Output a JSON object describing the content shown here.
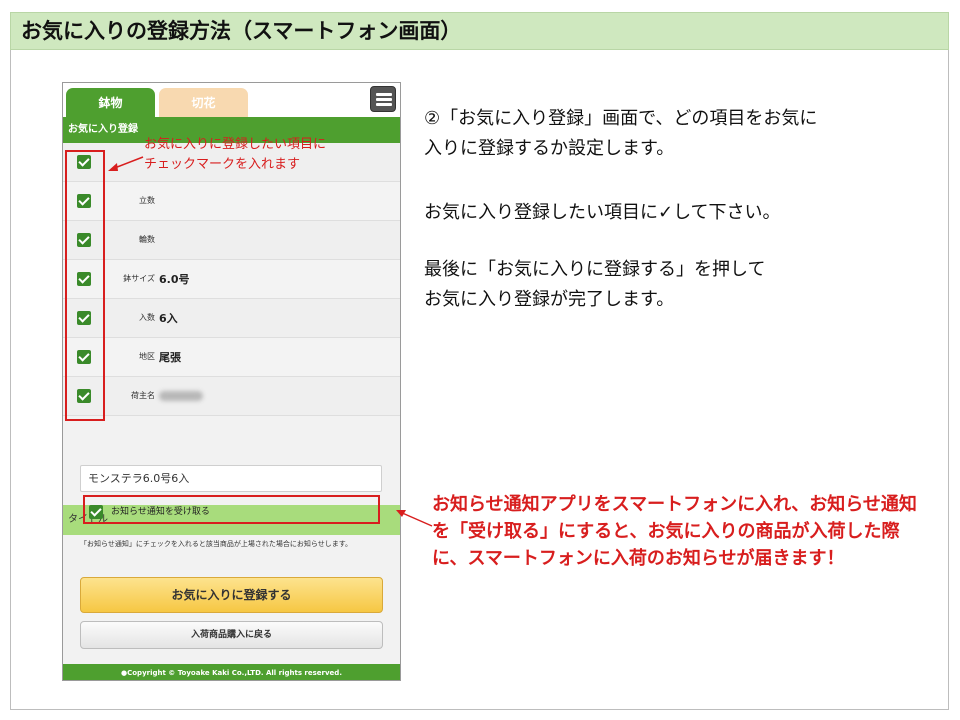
{
  "slide": {
    "title": "お気に入りの登録方法（スマートフォン画面）"
  },
  "phone": {
    "tabs": [
      {
        "label": "鉢物",
        "active": true
      },
      {
        "label": "切花",
        "active": false
      }
    ],
    "menu_icon": "hamburger-menu-icon",
    "favorites_header": "お気に入り登録",
    "rows": [
      {
        "label": "",
        "value": "",
        "checked": true
      },
      {
        "label": "立数",
        "value": "",
        "checked": true
      },
      {
        "label": "輪数",
        "value": "",
        "checked": true
      },
      {
        "label": "鉢サイズ",
        "value": "6.0号",
        "checked": true
      },
      {
        "label": "入数",
        "value": "6入",
        "checked": true
      },
      {
        "label": "地区",
        "value": "尾張",
        "checked": true
      },
      {
        "label": "荷主名",
        "value": "",
        "checked": true,
        "blurred": true
      }
    ],
    "title_section": "タイトル",
    "title_value": "モンステラ6.0号6入",
    "notify_label": "お知らせ通知を受け取る",
    "note": "「お知らせ通知」にチェックを入れると該当商品が上場された場合にお知らせします。",
    "register_button": "お気に入りに登録する",
    "back_button": "入荷商品購入に戻る",
    "footer": "●Copyright © Toyoake Kaki Co.,LTD. All rights reserved."
  },
  "annotations": {
    "checkbox_callout_line1": "お気に入りに登録したい項目に",
    "checkbox_callout_line2": "チェックマークを入れます",
    "notify_callout": "お知らせ通知アプリをスマートフォンに入れ、お知らせ通知を「受け取る」にすると、お気に入りの商品が入荷した際に、スマートフォンに入荷のお知らせが届きます！"
  },
  "description": {
    "para1_line1": "②「お気に入り登録」画面で、どの項目をお気に",
    "para1_line2": "入りに登録するか設定します。",
    "para2": "お気に入り登録したい項目に✓して下さい。",
    "para3_line1": "最後に「お気に入りに登録する」を押して",
    "para3_line2": "お気に入り登録が完了します。"
  },
  "colors": {
    "accent_green": "#4e9f2f",
    "highlight_red": "#d81e1e",
    "title_bg": "#cfe8bf"
  }
}
